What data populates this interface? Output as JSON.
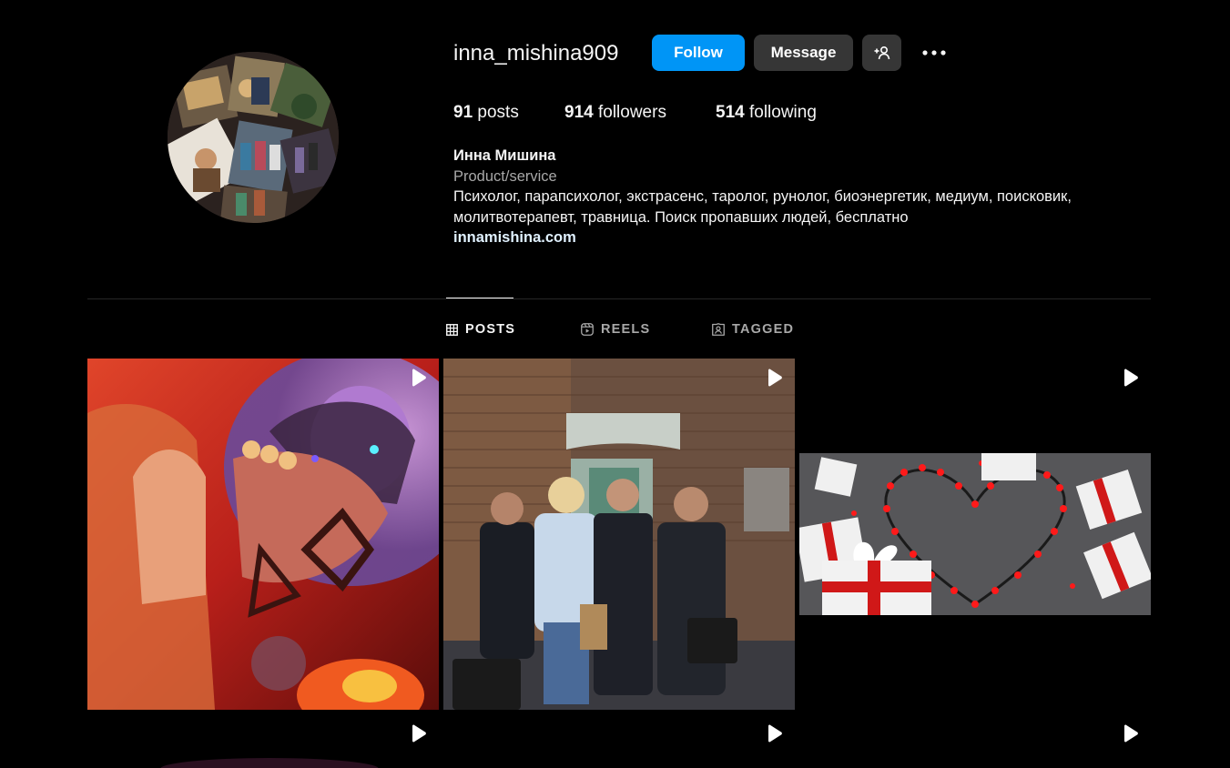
{
  "profile": {
    "username": "inna_mishina909",
    "buttons": {
      "follow": "Follow",
      "message": "Message"
    },
    "stats": {
      "posts_count": "91",
      "posts_label": "posts",
      "followers_count": "914",
      "followers_label": "followers",
      "following_count": "514",
      "following_label": "following"
    },
    "bio": {
      "full_name": "Инна Мишина",
      "category": "Product/service",
      "description": "Психолог, парапсихолог, экстрасенс, таролог, рунолог, биоэнергетик, медиум, поисковик, молитвотерапевт, травница. Поиск пропавших людей, бесплатно",
      "link": "innamishina.com"
    }
  },
  "tabs": [
    {
      "label": "POSTS",
      "icon": "grid-icon",
      "active": true
    },
    {
      "label": "REELS",
      "icon": "reels-icon",
      "active": false
    },
    {
      "label": "TAGGED",
      "icon": "tagged-icon",
      "active": false
    }
  ],
  "posts": [
    {
      "type": "reel",
      "subject": "portrait-red-light"
    },
    {
      "type": "reel",
      "subject": "group-photo-brick-building"
    },
    {
      "type": "reel",
      "subject": "red-lights-heart-gifts"
    },
    {
      "type": "reel"
    },
    {
      "type": "reel"
    },
    {
      "type": "reel"
    }
  ],
  "colors": {
    "background": "#000000",
    "primary_text": "#f5f5f5",
    "secondary_text": "#a8a8a8",
    "follow_button": "#0095f6",
    "secondary_button": "#363636",
    "link": "#e0f1ff",
    "divider": "#262626"
  }
}
